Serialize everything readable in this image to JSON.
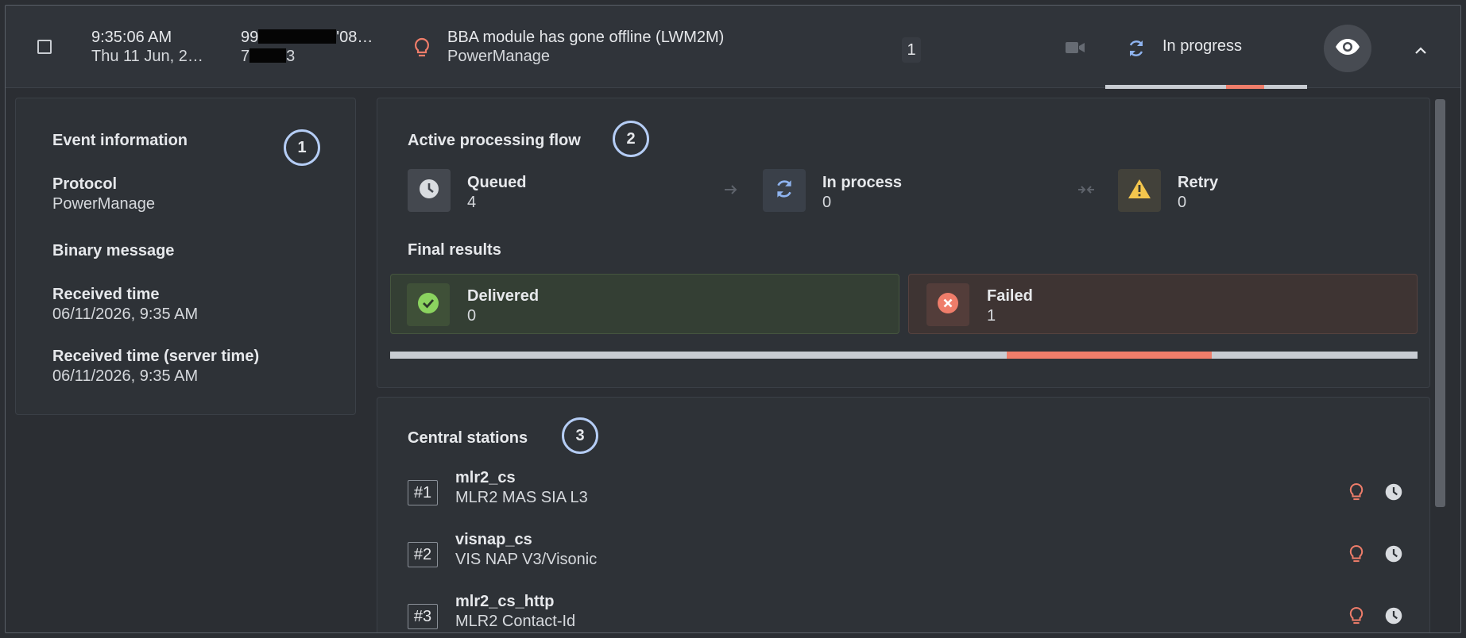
{
  "header": {
    "time": "9:35:06 AM",
    "date": "Thu 11 Jun, 2…",
    "id_line1_prefix": "99",
    "id_line1_suffix": "'08…",
    "id_line2_prefix": "7",
    "id_line2_suffix": "3",
    "event_title": "BBA module has gone offline (LWM2M)",
    "event_subtitle": "PowerManage",
    "count": "1",
    "status": "In progress"
  },
  "event_info": {
    "title": "Event information",
    "badge": "1",
    "protocol_label": "Protocol",
    "protocol_value": "PowerManage",
    "binary_label": "Binary message",
    "received_label": "Received time",
    "received_value": "06/11/2026, 9:35 AM",
    "received_server_label": "Received time (server time)",
    "received_server_value": "06/11/2026, 9:35 AM"
  },
  "processing": {
    "title": "Active processing flow",
    "badge": "2",
    "queued_label": "Queued",
    "queued_value": "4",
    "inprocess_label": "In process",
    "inprocess_value": "0",
    "retry_label": "Retry",
    "retry_value": "0",
    "final_title": "Final results",
    "delivered_label": "Delivered",
    "delivered_value": "0",
    "failed_label": "Failed",
    "failed_value": "1",
    "progress": {
      "delivered": 0,
      "failed": 1,
      "total": 5
    }
  },
  "stations": {
    "title": "Central stations",
    "badge": "3",
    "items": [
      {
        "num": "#1",
        "name": "mlr2_cs",
        "desc": "MLR2 MAS SIA L3"
      },
      {
        "num": "#2",
        "name": "visnap_cs",
        "desc": "VIS NAP V3/Visonic"
      },
      {
        "num": "#3",
        "name": "mlr2_cs_http",
        "desc": "MLR2 Contact-Id"
      }
    ]
  },
  "colors": {
    "accent_blue": "#8fb4f0",
    "alert_red": "#ef7d6a",
    "success_green": "#8bd35f",
    "warning_yellow": "#f4c64d"
  },
  "icons": [
    "checkbox-icon",
    "lightbulb-icon",
    "video-icon",
    "sync-icon",
    "eye-icon",
    "chevron-up-icon",
    "clock-icon",
    "arrow-right-icon",
    "merge-icon",
    "warning-icon",
    "check-circle-icon",
    "x-circle-icon"
  ]
}
